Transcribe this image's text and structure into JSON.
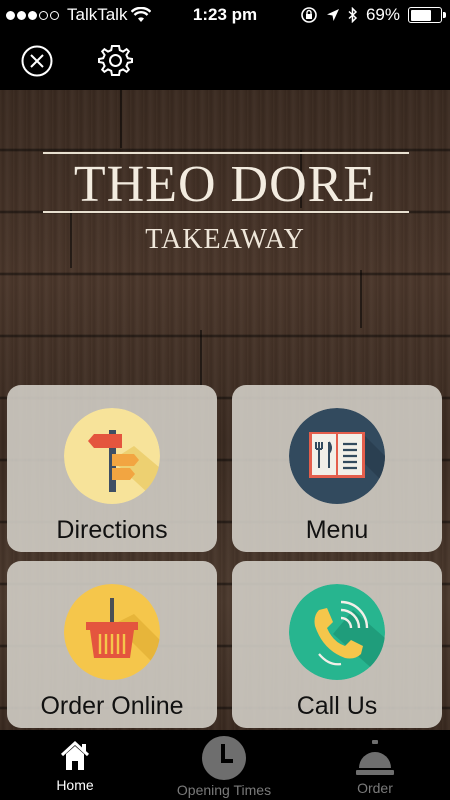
{
  "status_bar": {
    "carrier": "TalkTalk",
    "time": "1:23 pm",
    "battery_percent": "69%",
    "battery_level": 0.69,
    "signal_filled": 3,
    "signal_total": 5
  },
  "toolbar": {
    "close_icon": "close-circle-icon",
    "settings_icon": "gear-icon"
  },
  "hero": {
    "title": "THEO DORE",
    "subtitle": "TAKEAWAY"
  },
  "tiles": [
    {
      "label": "Directions",
      "icon": "signpost-icon",
      "icon_bg": "#f7e39a"
    },
    {
      "label": "Menu",
      "icon": "menu-book-icon",
      "icon_bg": "#324a5e"
    },
    {
      "label": "Order Online",
      "icon": "basket-icon",
      "icon_bg": "#f5c64b"
    },
    {
      "label": "Call Us",
      "icon": "phone-icon",
      "icon_bg": "#27b58f"
    }
  ],
  "tabbar": {
    "tabs": [
      {
        "label": "Home",
        "icon": "home-icon",
        "active": true
      },
      {
        "label": "Opening Times",
        "icon": "clock-icon",
        "active": false
      },
      {
        "label": "Order",
        "icon": "service-bell-icon",
        "active": false
      }
    ]
  },
  "colors": {
    "tab_active": "#ffffff",
    "tab_inactive": "#7a7a7a",
    "tile_bg": "#d5d1ca"
  }
}
